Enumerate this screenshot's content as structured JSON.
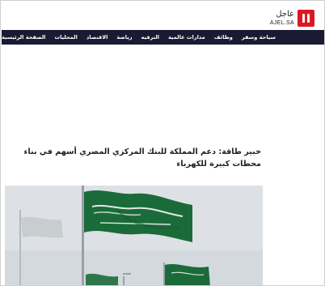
{
  "logo": {
    "arabic": "عاجل",
    "latin": "AJEL.SA",
    "brand_color": "#d71920",
    "icon": "logo-pause-mark"
  },
  "nav": {
    "background": "#1a1a33",
    "items": [
      {
        "label": "الصفحة الرئيسية"
      },
      {
        "label": "المحليات"
      },
      {
        "label": "الاقتصاد"
      },
      {
        "label": "رياضة"
      },
      {
        "label": "الترفيه"
      },
      {
        "label": "مدارات عالمية"
      },
      {
        "label": "وظائف"
      },
      {
        "label": "سياحة وسفر"
      }
    ]
  },
  "article": {
    "headline": "خبير طاقة: دعم المملكة للبنك المركزي المصري أسهم في بناء محطات كبيرة للكهرباء",
    "image_subject": "flags-photo",
    "flag_color": "#1b6b3a"
  }
}
